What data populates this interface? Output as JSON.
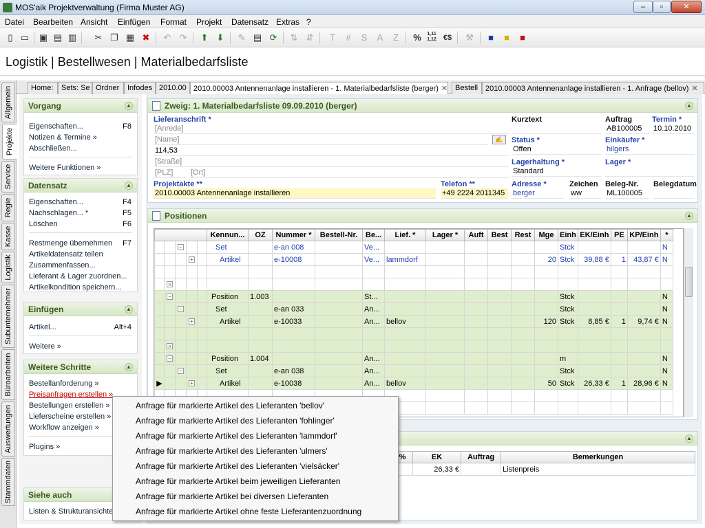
{
  "window": {
    "title": "MOS'aik Projektverwaltung (Firma Muster AG)",
    "min": "–",
    "max": "▫",
    "close": "✕"
  },
  "menu": [
    "Datei",
    "Bearbeiten",
    "Ansicht",
    "Einfügen",
    "Format",
    "Projekt",
    "Datensatz",
    "Extras",
    "?"
  ],
  "toolbar": {
    "percent": "%",
    "decimals": "1,11 1,12",
    "currency": "€$",
    "t": "T",
    "hash": "#",
    "s": "S",
    "a": "A",
    "z": "Z"
  },
  "breadcrumb": "Logistik | Bestellwesen | Materialbedarfsliste",
  "vtabs": [
    "Allgemein",
    "Projekte",
    "Service",
    "Regie",
    "Kasse",
    "Logistik",
    "Subunternehmer",
    "Büroarbeiten",
    "Auswertungen",
    "Stammdaten"
  ],
  "doctabs": [
    "Home: ",
    "Sets: Se",
    "Ordner",
    "Infodes",
    "2010.00",
    "2010.00003 Antennenanlage installieren - 1. Materialbedarfsliste (berger)",
    "Bestell",
    "2010.00003 Antennenanlage installieren - 1. Anfrage (bellov)"
  ],
  "left": {
    "vorgang": {
      "title": "Vorgang",
      "items": [
        {
          "label": "Eigenschaften...",
          "key": "F8"
        },
        {
          "label": "Notizen & Termine »",
          "key": ""
        },
        {
          "label": "Abschließen...",
          "key": ""
        },
        {
          "label": "Weitere Funktionen »",
          "key": ""
        }
      ]
    },
    "datensatz": {
      "title": "Datensatz",
      "items": [
        {
          "label": "Eigenschaften...",
          "key": "F4"
        },
        {
          "label": "Nachschlagen... *",
          "key": "F5"
        },
        {
          "label": "Löschen",
          "key": "F6"
        },
        {
          "label": "Restmenge übernehmen",
          "key": "F7"
        },
        {
          "label": "Artikeldatensatz teilen",
          "key": ""
        },
        {
          "label": "Zusammenfassen...",
          "key": ""
        },
        {
          "label": "Lieferant & Lager zuordnen...",
          "key": ""
        },
        {
          "label": "Artikelkondition speichern...",
          "key": ""
        }
      ]
    },
    "einfuegen": {
      "title": "Einfügen",
      "items": [
        {
          "label": "Artikel...",
          "key": "Alt+4"
        },
        {
          "label": "Weitere »",
          "key": ""
        }
      ]
    },
    "weitere": {
      "title": "Weitere Schritte",
      "items": [
        {
          "label": "Bestellanforderung »",
          "key": ""
        },
        {
          "label": "Preisanfragen erstellen »",
          "key": ""
        },
        {
          "label": "Bestellungen erstellen »",
          "key": ""
        },
        {
          "label": "Lieferscheine erstellen »",
          "key": ""
        },
        {
          "label": "Workflow anzeigen »",
          "key": ""
        },
        {
          "label": "Plugins »",
          "key": ""
        }
      ]
    },
    "siehe": {
      "title": "Siehe auch",
      "items": [
        {
          "label": "Listen & Strukturansichten",
          "key": ""
        }
      ]
    }
  },
  "zweig": {
    "title": "Zweig: 1. Materialbedarfsliste 09.09.2010 (berger)",
    "lieferanschrift_label": "Lieferanschrift *",
    "anrede": "[Anrede]",
    "name": "[Name]",
    "line3": "114,53",
    "strasse": "[Straße]",
    "plz": "[PLZ]",
    "ort": "[Ort]",
    "projektakte_label": "Projektakte **",
    "projektakte": "2010.00003 Antennenanlage installieren",
    "telefon_label": "Telefon **",
    "telefon": "+49 2224 2011345",
    "kurztext_label": "Kurztext",
    "kurztext": "",
    "status_label": "Status *",
    "status": "Offen",
    "lagerhaltung_label": "Lagerhaltung *",
    "lagerhaltung": "Standard",
    "adresse_label": "Adresse *",
    "adresse": "berger",
    "zeichen_label": "Zeichen",
    "zeichen": "ww",
    "auftrag_label": "Auftrag",
    "auftrag": "AB100005",
    "termin_label": "Termin *",
    "termin": "10.10.2010",
    "einkaeufer_label": "Einkäufer *",
    "einkaeufer": "hilgers",
    "lager_label": "Lager *",
    "lager": "",
    "belegnr_label": "Beleg-Nr.",
    "belegnr": "ML100005",
    "belegdatum_label": "Belegdatum",
    "belegdatum": ""
  },
  "positionen": {
    "title": "Positionen",
    "columns": [
      "Kennun...",
      "OZ",
      "Nummer *",
      "Bestell-Nr.",
      "Be...",
      "Lief. *",
      "Lager *",
      "Auft",
      "Best",
      "Rest",
      "Mge",
      "Einh",
      "EK/Einh",
      "PE",
      "KP/Einh",
      "*"
    ],
    "rows": [
      {
        "tree": "set",
        "kind": "Set",
        "oz": "",
        "nr": "e-an 008",
        "be": "Ve...",
        "lief": "",
        "mge": "",
        "einh": "Stck",
        "ek": "",
        "pe": "",
        "kp": "",
        "flag": "N",
        "cls": "bluetxt"
      },
      {
        "tree": "art",
        "kind": "Artikel",
        "oz": "",
        "nr": "e-10008",
        "be": "Ve...",
        "lief": "lammdorf",
        "mge": "20",
        "einh": "Stck",
        "ek": "39,88 €",
        "pe": "1",
        "kp": "43,87 €",
        "flag": "N",
        "cls": "bluetxt"
      },
      {
        "tree": "empty",
        "kind": "",
        "oz": "",
        "nr": "",
        "be": "",
        "lief": "",
        "mge": "",
        "einh": "",
        "ek": "",
        "pe": "",
        "kp": "",
        "flag": "",
        "cls": ""
      },
      {
        "tree": "dbl",
        "kind": "",
        "oz": "",
        "nr": "",
        "be": "",
        "lief": "",
        "mge": "",
        "einh": "",
        "ek": "",
        "pe": "",
        "kp": "",
        "flag": "",
        "cls": ""
      },
      {
        "tree": "pos",
        "kind": "Position",
        "oz": "1.003",
        "nr": "",
        "be": "St...",
        "lief": "",
        "mge": "",
        "einh": "Stck",
        "ek": "",
        "pe": "",
        "kp": "",
        "flag": "N",
        "cls": "green"
      },
      {
        "tree": "set",
        "kind": "Set",
        "oz": "",
        "nr": "e-an 033",
        "be": "An...",
        "lief": "",
        "mge": "",
        "einh": "Stck",
        "ek": "",
        "pe": "",
        "kp": "",
        "flag": "N",
        "cls": "green"
      },
      {
        "tree": "art",
        "kind": "Artikel",
        "oz": "",
        "nr": "e-10033",
        "be": "An...",
        "lief": "bellov",
        "mge": "120",
        "einh": "Stck",
        "ek": "8,85 €",
        "pe": "1",
        "kp": "9,74 €",
        "flag": "N",
        "cls": "green"
      },
      {
        "tree": "empty",
        "kind": "",
        "oz": "",
        "nr": "",
        "be": "",
        "lief": "",
        "mge": "",
        "einh": "",
        "ek": "",
        "pe": "",
        "kp": "",
        "flag": "",
        "cls": "green"
      },
      {
        "tree": "dbl",
        "kind": "",
        "oz": "",
        "nr": "",
        "be": "",
        "lief": "",
        "mge": "",
        "einh": "",
        "ek": "",
        "pe": "",
        "kp": "",
        "flag": "",
        "cls": "green"
      },
      {
        "tree": "pos",
        "kind": "Position",
        "oz": "1.004",
        "nr": "",
        "be": "An...",
        "lief": "",
        "mge": "",
        "einh": "m",
        "ek": "",
        "pe": "",
        "kp": "",
        "flag": "N",
        "cls": "green"
      },
      {
        "tree": "set",
        "kind": "Set",
        "oz": "",
        "nr": "e-an 038",
        "be": "An...",
        "lief": "",
        "mge": "",
        "einh": "Stck",
        "ek": "",
        "pe": "",
        "kp": "",
        "flag": "N",
        "cls": "green"
      },
      {
        "tree": "art",
        "kind": "Artikel",
        "oz": "",
        "nr": "e-10038",
        "be": "An...",
        "lief": "bellov",
        "mge": "50",
        "einh": "Stck",
        "ek": "26,33 €",
        "pe": "1",
        "kp": "28,96 €",
        "flag": "N",
        "cls": "green",
        "current": true
      },
      {
        "tree": "empty",
        "kind": "",
        "oz": "",
        "nr": "",
        "be": "",
        "lief": "",
        "mge": "",
        "einh": "",
        "ek": "",
        "pe": "",
        "kp": "",
        "flag": "",
        "cls": ""
      },
      {
        "tree": "empty",
        "kind": "",
        "oz": "",
        "nr": "",
        "be": "",
        "lief": "",
        "mge": "",
        "einh": "",
        "ek": "",
        "pe": "",
        "kp": "",
        "flag": "",
        "cls": ""
      }
    ]
  },
  "bottom": {
    "columns": [
      "%",
      "EK",
      "Auftrag",
      "Bemerkungen"
    ],
    "row": {
      "pct": "",
      "ek": "26,33 €",
      "auftrag": "",
      "bemerkungen": "Listenpreis"
    }
  },
  "popup": [
    "Anfrage für markierte Artikel des Lieferanten 'bellov'",
    "Anfrage für markierte Artikel des Lieferanten 'fohlinger'",
    "Anfrage für markierte Artikel des Lieferanten 'lammdorf'",
    "Anfrage für markierte Artikel des Lieferanten 'ulmers'",
    "Anfrage für markierte Artikel des Lieferanten 'vielsäcker'",
    "Anfrage für markierte Artikel beim jeweiligen Lieferanten",
    "Anfrage für markierte Artikel bei diversen Lieferanten",
    "Anfrage für markierte Artikel ohne feste Lieferantenzuordnung"
  ]
}
